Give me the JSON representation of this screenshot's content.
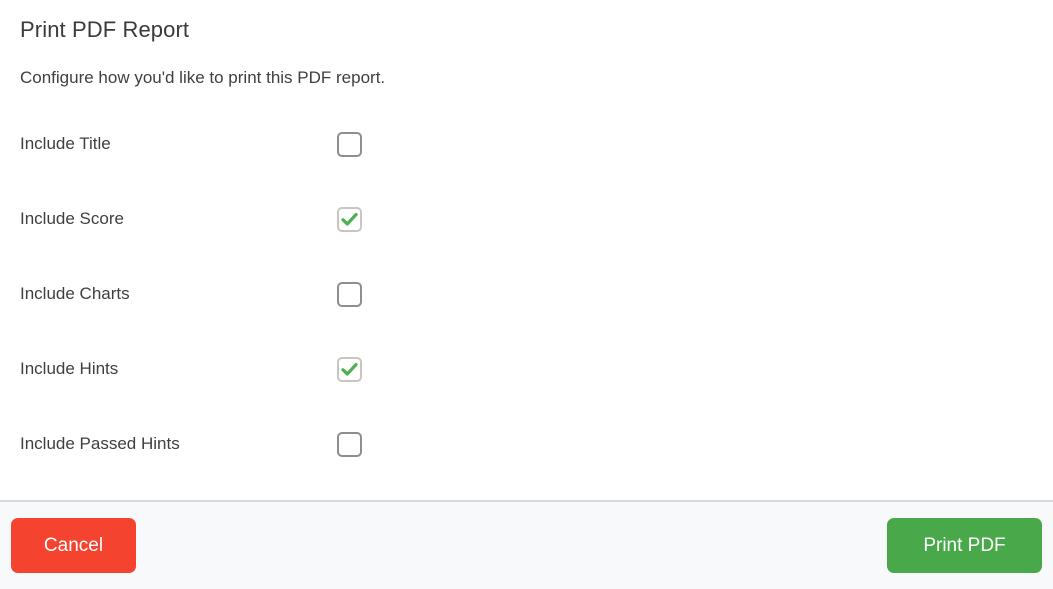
{
  "dialog": {
    "title": "Print PDF Report",
    "subtitle": "Configure how you'd like to print this PDF report.",
    "options": [
      {
        "label": "Include Title",
        "checked": false
      },
      {
        "label": "Include Score",
        "checked": true
      },
      {
        "label": "Include Charts",
        "checked": false
      },
      {
        "label": "Include Hints",
        "checked": true
      },
      {
        "label": "Include Passed Hints",
        "checked": false
      }
    ],
    "footer": {
      "cancel_label": "Cancel",
      "print_label": "Print PDF"
    }
  },
  "colors": {
    "cancel_button": "#f4432f",
    "print_button": "#49a94a",
    "checkmark": "#4caf50",
    "checkbox_border": "#8e8e8e",
    "checkbox_border_checked": "#c9c6bd",
    "footer_background": "#f8f9fa",
    "divider": "#d8d8d8",
    "text": "#3f3f3f"
  },
  "icons": {
    "checkmark": "check-icon"
  }
}
